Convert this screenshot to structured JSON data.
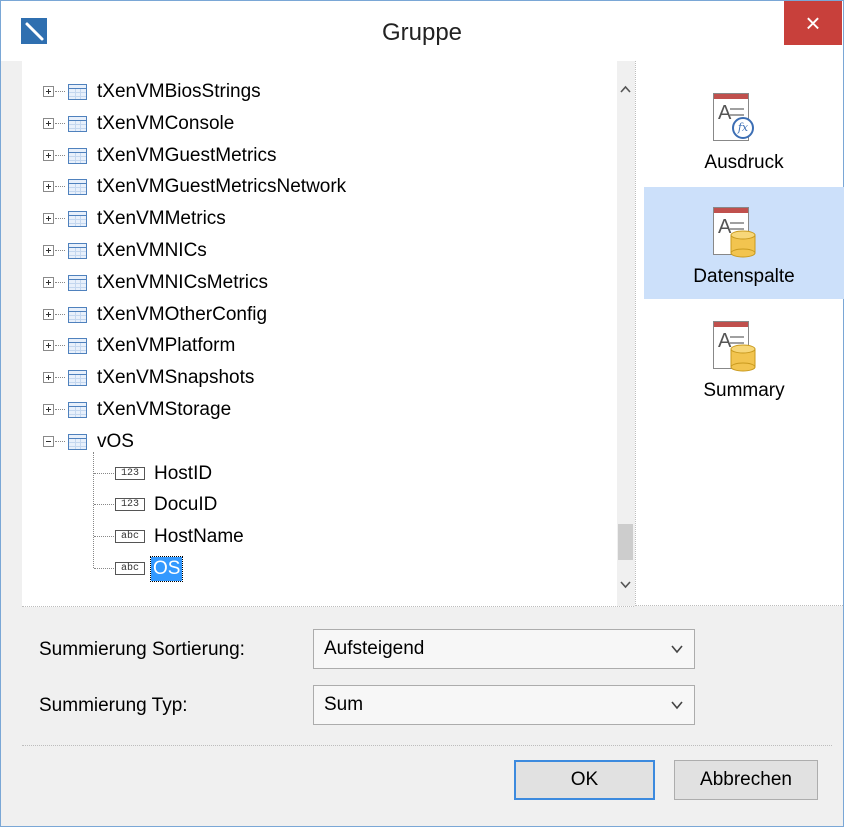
{
  "window": {
    "title": "Gruppe",
    "close_symbol": "×",
    "app_icon": "pencil-icon"
  },
  "tree": {
    "tables": [
      {
        "label": "tXenVMBiosStrings",
        "expanded": false
      },
      {
        "label": "tXenVMConsole",
        "expanded": false
      },
      {
        "label": "tXenVMGuestMetrics",
        "expanded": false
      },
      {
        "label": "tXenVMGuestMetricsNetwork",
        "expanded": false
      },
      {
        "label": "tXenVMMetrics",
        "expanded": false
      },
      {
        "label": "tXenVMNICs",
        "expanded": false
      },
      {
        "label": "tXenVMNICsMetrics",
        "expanded": false
      },
      {
        "label": "tXenVMOtherConfig",
        "expanded": false
      },
      {
        "label": "tXenVMPlatform",
        "expanded": false
      },
      {
        "label": "tXenVMSnapshots",
        "expanded": false
      },
      {
        "label": "tXenVMStorage",
        "expanded": false
      },
      {
        "label": "vOS",
        "expanded": true
      }
    ],
    "fields": [
      {
        "type": "123",
        "label": "HostID"
      },
      {
        "type": "123",
        "label": "DocuID"
      },
      {
        "type": "abc",
        "label": "HostName"
      },
      {
        "type": "abc",
        "label": "OS",
        "selected": true
      }
    ],
    "scroll_up_symbol": "⌃",
    "scroll_down_symbol": "⌄",
    "scroll_position": 0.97
  },
  "side_panel": {
    "items": [
      {
        "label": "Ausdruck",
        "icon": "expression-icon",
        "active": false
      },
      {
        "label": "Datenspalte",
        "icon": "data-column-icon",
        "active": true
      },
      {
        "label": "Summary",
        "icon": "summary-icon",
        "active": false
      }
    ],
    "doc_letter": "A",
    "fx_text": "fx"
  },
  "form": {
    "sort_label": "Summierung Sortierung:",
    "sort_value": "Aufsteigend",
    "type_label": "Summierung Typ:",
    "type_value": "Sum"
  },
  "buttons": {
    "ok": "OK",
    "cancel": "Abbrechen"
  },
  "colors": {
    "selection": "#3399ff",
    "active_side_item": "#cce0fa",
    "close_button": "#c8403b",
    "default_button_border": "#3c8ade"
  }
}
